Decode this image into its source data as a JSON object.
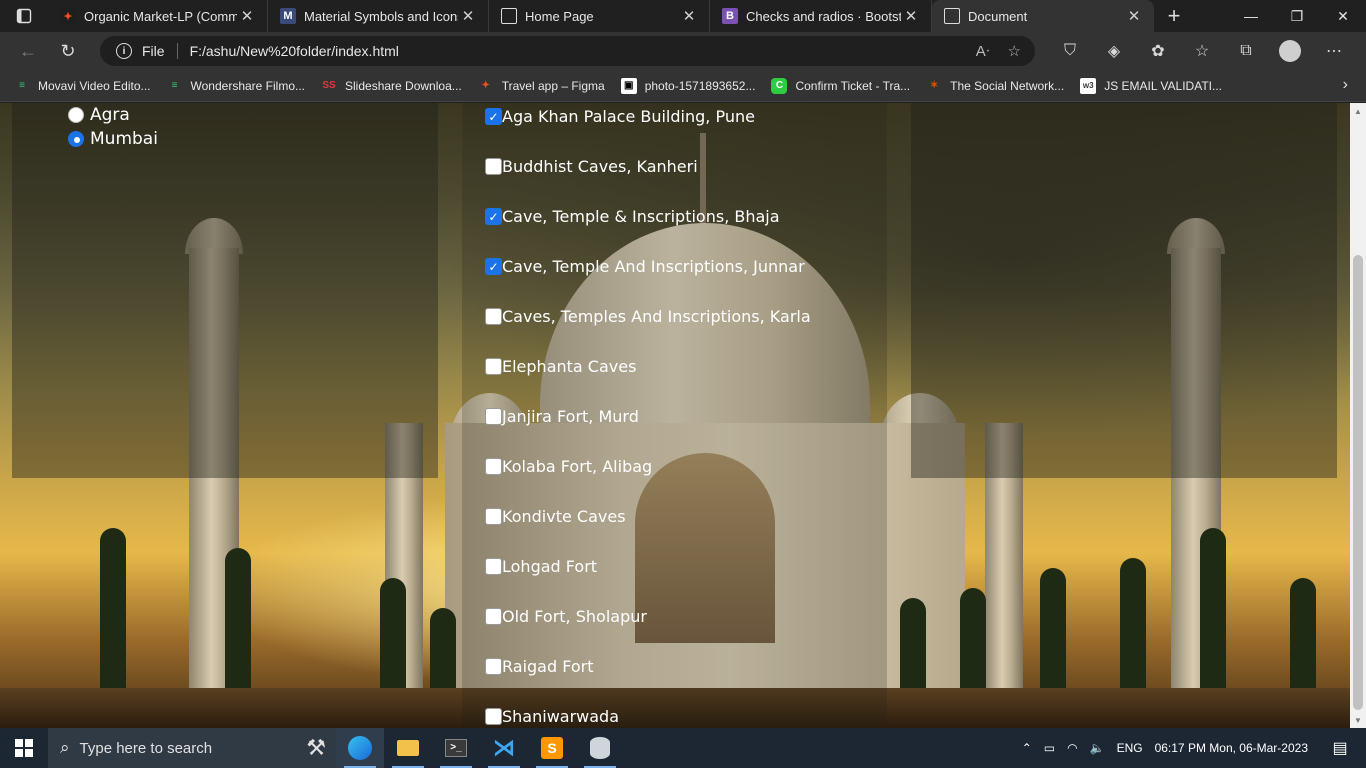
{
  "browser": {
    "tabs": [
      {
        "title": "Organic Market-LP (Communi",
        "icon": "figma-icon",
        "color": "#a259ff"
      },
      {
        "title": "Material Symbols and Icons -",
        "icon": "material-icon",
        "color": "#3c4a7a"
      },
      {
        "title": "Home Page",
        "icon": "page-icon",
        "color": "#555555"
      },
      {
        "title": "Checks and radios · Bootstrap",
        "icon": "bootstrap-icon",
        "color": "#7952b3"
      },
      {
        "title": "Document",
        "icon": "page-icon",
        "color": "#555555"
      }
    ],
    "address": {
      "protocol_label": "File",
      "url": "F:/ashu/New%20folder/index.html"
    },
    "bookmarks": [
      {
        "label": "Movavi Video Edito...",
        "icon": "movavi-icon",
        "color": "#2ecc71"
      },
      {
        "label": "Wondershare Filmo...",
        "icon": "filmora-icon",
        "color": "#2ecc71"
      },
      {
        "label": "Slideshare Downloa...",
        "icon": "slideshare-icon",
        "color": "#e03a3a"
      },
      {
        "label": "Travel app – Figma",
        "icon": "figma-icon",
        "color": "#f24e1e"
      },
      {
        "label": "photo-1571893652...",
        "icon": "photo-icon",
        "color": "#ffffff"
      },
      {
        "label": "Confirm Ticket - Tra...",
        "icon": "confirmtkt-icon",
        "color": "#2ecc40"
      },
      {
        "label": "The Social Network...",
        "icon": "social-icon",
        "color": "#d35400"
      },
      {
        "label": "JS EMAIL VALIDATI...",
        "icon": "w3-icon",
        "color": "#ffffff"
      }
    ]
  },
  "page": {
    "radios": [
      {
        "label": "Agra",
        "checked": false
      },
      {
        "label": "Mumbai",
        "checked": true
      }
    ],
    "checkboxes": [
      {
        "label": "Aga Khan Palace Building, Pune",
        "checked": true
      },
      {
        "label": "Buddhist Caves, Kanheri",
        "checked": false
      },
      {
        "label": "Cave, Temple & Inscriptions, Bhaja",
        "checked": true
      },
      {
        "label": "Cave, Temple And Inscriptions, Junnar",
        "checked": true
      },
      {
        "label": "Caves, Temples And Inscriptions, Karla",
        "checked": false
      },
      {
        "label": "Elephanta Caves",
        "checked": false
      },
      {
        "label": "Janjira Fort, Murd",
        "checked": false
      },
      {
        "label": "Kolaba Fort, Alibag",
        "checked": false
      },
      {
        "label": "Kondivte Caves",
        "checked": false
      },
      {
        "label": "Lohgad Fort",
        "checked": false
      },
      {
        "label": "Old Fort, Sholapur",
        "checked": false
      },
      {
        "label": "Raigad Fort",
        "checked": false
      },
      {
        "label": "Shaniwarwada",
        "checked": false
      }
    ]
  },
  "taskbar": {
    "search_placeholder": "Type here to search",
    "language": "ENG",
    "clock": "06:17 PM Mon, 06-Mar-2023"
  }
}
